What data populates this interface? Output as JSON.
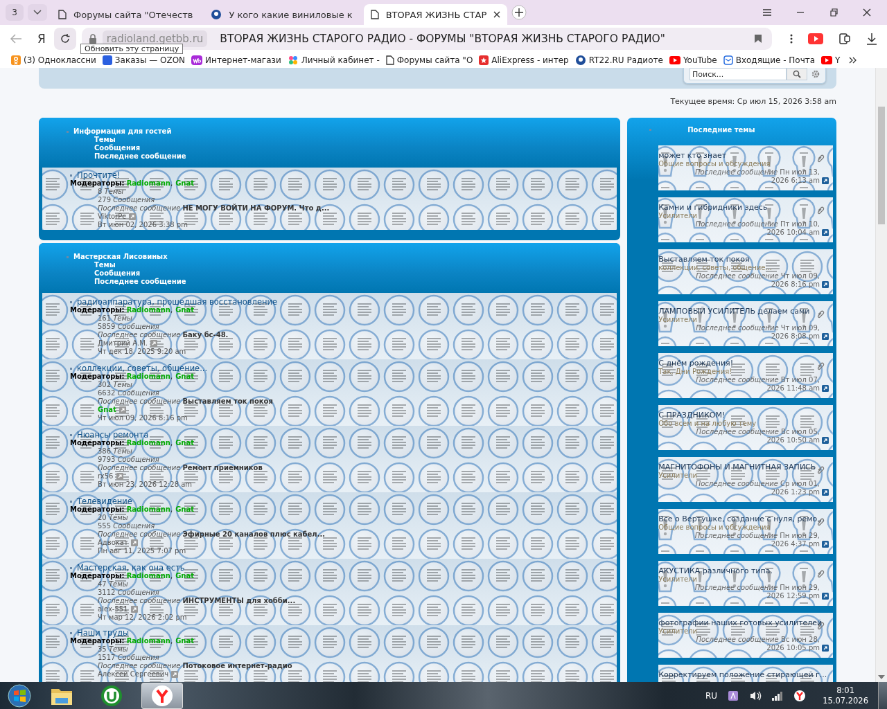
{
  "browser": {
    "tab_count": "3",
    "tabs": [
      {
        "title": "Форумы сайта \"Отечеств",
        "selected": false,
        "kind": "page"
      },
      {
        "title": "У кого какие виниловые к",
        "selected": false,
        "kind": "site"
      },
      {
        "title": "ВТОРАЯ ЖИЗНЬ СТАР",
        "selected": true,
        "kind": "page"
      }
    ],
    "home_glyph": "Я",
    "domain": "radioland.getbb.ru",
    "page_title": "ВТОРАЯ ЖИЗНЬ СТАРОГО РАДИО - ФОРУМЫ \"ВТОРАЯ ЖИЗНЬ СТАРОГО РАДИО\"",
    "tooltip": "Обновить эту страницу",
    "bookmarks": [
      {
        "label": "(3) Одноклассни",
        "kind": "ok"
      },
      {
        "label": "Заказы — OZON",
        "kind": "ozon"
      },
      {
        "label": "Интернет-магази",
        "kind": "wb"
      },
      {
        "label": "Личный кабинет -",
        "kind": "dots"
      },
      {
        "label": "Форумы сайта \"О",
        "kind": "page"
      },
      {
        "label": "AliExpress - интер",
        "kind": "ali"
      },
      {
        "label": "RT22.RU Радиоте",
        "kind": "site"
      },
      {
        "label": "YouTube",
        "kind": "youtube"
      },
      {
        "label": "Входящие - Почта",
        "kind": "mail"
      },
      {
        "label": "Y",
        "kind": "youtube"
      }
    ]
  },
  "search": {
    "placeholder": "Поиск..."
  },
  "current_time": "Текущее время: Ср июл 15, 2026 3:58 am",
  "categories": [
    {
      "title": "Информация для гостей",
      "columns": [
        "Темы",
        "Сообщения",
        "Последнее сообщение"
      ],
      "forums": [
        {
          "title": "Прочтите!",
          "moderators_label": "Модераторы:",
          "moderators": [
            "Radiomann",
            "Gnat"
          ],
          "moderator_separator": ",",
          "topics": "8",
          "topics_label": "Темы",
          "posts": "279",
          "posts_label": "Сообщения",
          "last_label": "Последнее сообщение",
          "last_title": "НЕ МОГУ ВОЙТИ НА ФОРУМ. Что д...",
          "author": "ViktorPc",
          "author_moderator": false,
          "date": "Вт июн 02, 2026 3:38 pm"
        }
      ]
    },
    {
      "title": "Мастерская Лисовиных",
      "columns": [
        "Темы",
        "Сообщения",
        "Последнее сообщение"
      ],
      "forums": [
        {
          "title": "радиоаппаратура, прошедшая восстановление",
          "moderators_label": "Модераторы:",
          "moderators": [
            "Radiomann",
            "Gnat"
          ],
          "moderator_separator": ",",
          "topics": "161",
          "topics_label": "Темы",
          "posts": "5859",
          "posts_label": "Сообщения",
          "last_label": "Последнее сообщение",
          "last_title": "Баку бс-48.",
          "author": "Дмитрий А.М.",
          "author_moderator": false,
          "date": "Чт дек 18, 2025 9:20 am"
        },
        {
          "title": "коллекции, советы, общение...",
          "moderators_label": "Модераторы:",
          "moderators": [
            "Radiomann",
            "Gnat"
          ],
          "moderator_separator": ",",
          "topics": "302",
          "topics_label": "Темы",
          "posts": "6632",
          "posts_label": "Сообщения",
          "last_label": "Последнее сообщение",
          "last_title": "Выставляем ток покоя",
          "author": "Gnat",
          "author_moderator": true,
          "date": "Чт июл 09, 2026 8:16 pm"
        },
        {
          "title": "Нюансы ремонта",
          "moderators_label": "Модераторы:",
          "moderators": [
            "Radiomann",
            "Gnat"
          ],
          "moderator_separator": ",",
          "topics": "386",
          "topics_label": "Темы",
          "posts": "9793",
          "posts_label": "Сообщения",
          "last_label": "Последнее сообщение",
          "last_title": "Ремонт приемников",
          "author": "rx56",
          "author_moderator": false,
          "date": "Вт июн 23, 2026 12:28 am"
        },
        {
          "title": "Телевидение",
          "moderators_label": "Модераторы:",
          "moderators": [
            "Radiomann",
            "Gnat"
          ],
          "moderator_separator": ",",
          "topics": "20",
          "topics_label": "Темы",
          "posts": "555",
          "posts_label": "Сообщения",
          "last_label": "Последнее сообщение",
          "last_title": "Эфирные 20 каналов плюс кабел...",
          "author": "Адвокат",
          "author_moderator": false,
          "date": "Пн авг 11, 2025 7:07 pm"
        },
        {
          "title": "Мастерская, как она есть",
          "moderators_label": "Модераторы:",
          "moderators": [
            "Radiomann",
            "Gnat"
          ],
          "moderator_separator": ",",
          "topics": "47",
          "topics_label": "Темы",
          "posts": "3112",
          "posts_label": "Сообщения",
          "last_label": "Последнее сообщение",
          "last_title": "ИНСТРУМЕНТЫ для хобби...",
          "author": "alex-551",
          "author_moderator": false,
          "date": "Чт мар 12, 2026 2:02 pm"
        },
        {
          "title": "Наши труды",
          "moderators_label": "Модераторы:",
          "moderators": [
            "Radiomann",
            "Gnat"
          ],
          "moderator_separator": ",",
          "topics": "35",
          "topics_label": "Темы",
          "posts": "1517",
          "posts_label": "Сообщения",
          "last_label": "Последнее сообщение",
          "last_title": "Потоковое интернет-радио",
          "author": "Алексей Сергеевич",
          "author_moderator": false
        }
      ]
    }
  ],
  "recent": {
    "title": "Последние темы",
    "topics": [
      {
        "title": "может кто знает",
        "forum": "Общие вопросы и обсуждения",
        "last_label": "Последнее сообщение",
        "date": "Пн июл 13, 2026 6:13 am",
        "kind": "sticky",
        "attachment": true
      },
      {
        "title": "Камни и гибридники здесь",
        "forum": "Усилители",
        "last_label": "Последнее сообщение",
        "date": "Пт июл 10, 2026 10:04 am",
        "kind": "sticky",
        "attachment": true
      },
      {
        "title": "Выставляем ток покоя",
        "forum": "коллекции, советы, общение...",
        "last_label": "Последнее сообщение",
        "date": "Чт июл 09, 2026 8:16 pm",
        "kind": "normal",
        "attachment": false
      },
      {
        "title": "ЛАМПОВЫЙ УСИЛИТЕЛЬ делаем сами",
        "forum": "Усилители",
        "last_label": "Последнее сообщение",
        "date": "Чт июл 09, 2026 8:08 pm",
        "kind": "sticky",
        "attachment": true
      },
      {
        "title": "С днём рождения!",
        "forum": "Так, Дни Рождения!",
        "last_label": "Последнее сообщение",
        "date": "Вт июл 07, 2026 11:48 am",
        "kind": "normal",
        "attachment": true
      },
      {
        "title": "С ПРАЗДНИКОМ!",
        "forum": "Обо всем и на любую тему",
        "last_label": "Последнее сообщение",
        "date": "Вс июл 05, 2026 10:50 am",
        "kind": "normal",
        "attachment": false
      },
      {
        "title": "МАГНИТОФОНЫ И МАГНИТНАЯ ЗАПИСЬ",
        "forum": "Усилители",
        "last_label": "Последнее сообщение",
        "date": "Ср июл 01, 2026 1:23 pm",
        "kind": "normal",
        "attachment": true
      },
      {
        "title": "Все о Вертушке, создание с нуля, ремо...",
        "forum": "Общие вопросы и обсуждения",
        "last_label": "Последнее сообщение",
        "date": "Пн июн 29, 2026 4:37 pm",
        "kind": "sticky",
        "attachment": true
      },
      {
        "title": "АКУСТИКА различного типа.",
        "forum": "Усилители",
        "last_label": "Последнее сообщение",
        "date": "Пн июн 29, 2026 12:59 pm",
        "kind": "sticky",
        "attachment": true
      },
      {
        "title": "фотографии наших готовых усилителей",
        "forum": "Усилители",
        "last_label": "Последнее сообщение",
        "date": "Вс июн 28, 2026 10:05 pm",
        "kind": "normal",
        "attachment": true
      },
      {
        "title": "Корректируем положение стирающей г...",
        "kind": "normal",
        "attachment": false
      }
    ]
  },
  "taskbar": {
    "apps": [
      {
        "kind": "explorer",
        "selected": false
      },
      {
        "kind": "utorrent",
        "selected": false
      },
      {
        "kind": "yandex",
        "selected": true
      }
    ],
    "lang": "RU",
    "time": "8:01",
    "date": "15.07.2026"
  }
}
